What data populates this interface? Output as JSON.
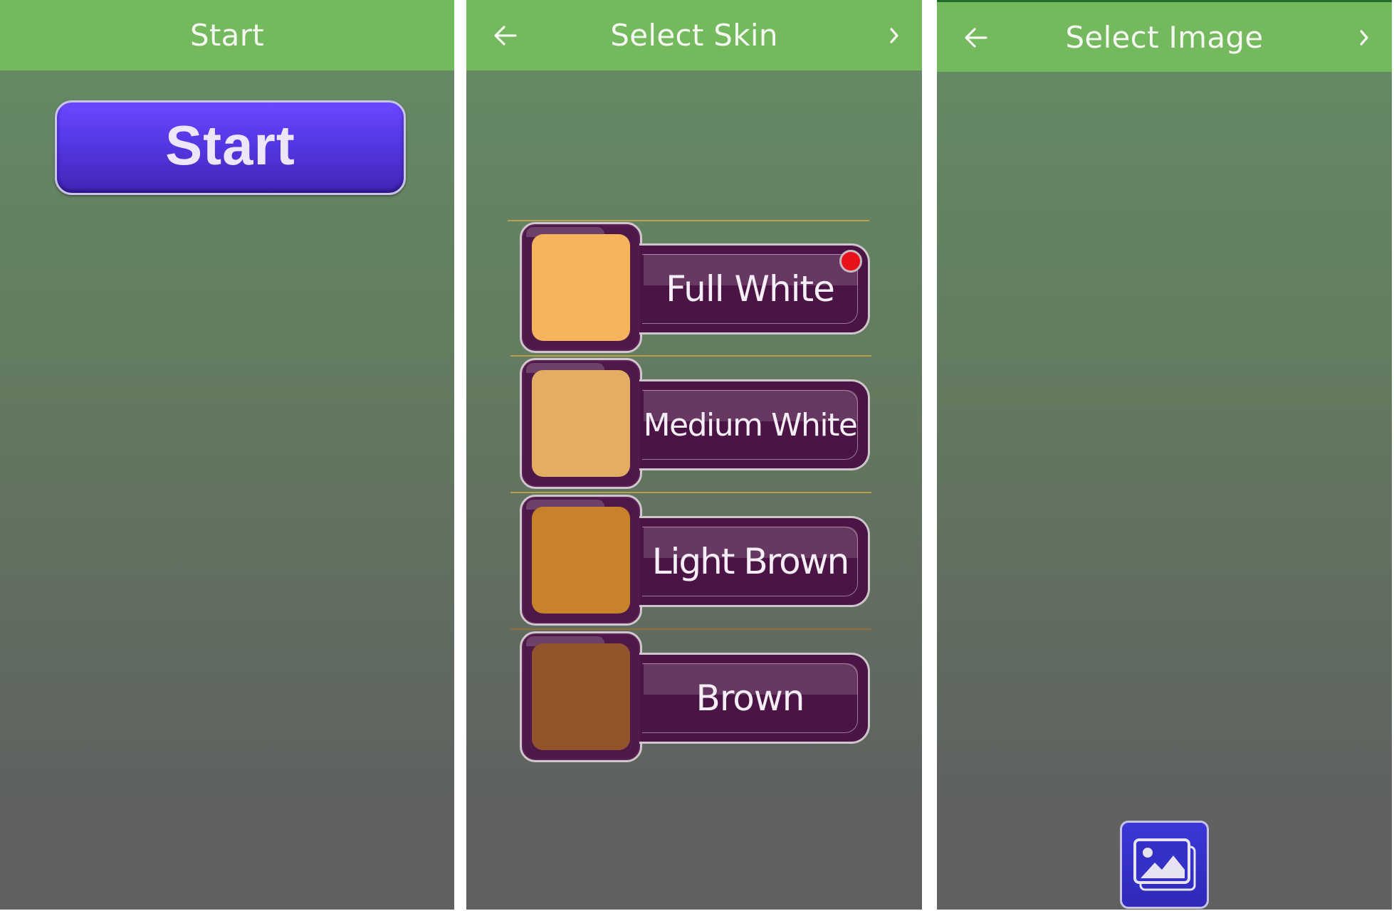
{
  "screens": {
    "start": {
      "title": "Start",
      "start_button_label": "Start"
    },
    "select_skin": {
      "title": "Select Skin",
      "back_icon": "arrow-left-icon",
      "forward_icon": "chevron-right-icon",
      "options": [
        {
          "label": "Full White",
          "color": "#f5b35c",
          "selected": true
        },
        {
          "label": "Medium White",
          "color": "#e4ad64",
          "selected": false
        },
        {
          "label": "Light Brown",
          "color": "#c8832a",
          "selected": false
        },
        {
          "label": "Brown",
          "color": "#92552b",
          "selected": false
        }
      ]
    },
    "select_image": {
      "title": "Select Image",
      "back_icon": "arrow-left-icon",
      "forward_icon": "chevron-right-icon",
      "gallery_icon": "image-gallery-icon"
    }
  },
  "colors": {
    "appbar": "#75b95e",
    "start_button": "#5537e4",
    "skin_frame": "#4a1444",
    "selected_indicator": "#e8121a",
    "gallery_button": "#3530c8"
  }
}
